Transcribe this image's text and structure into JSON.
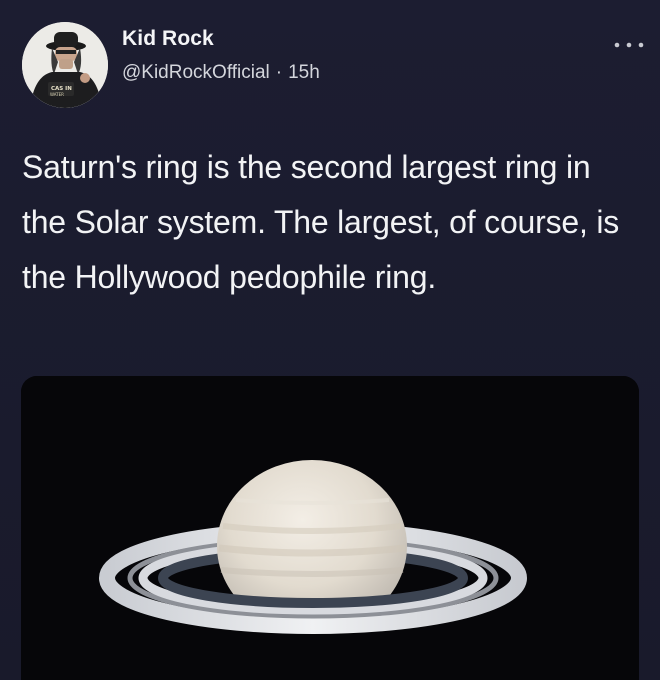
{
  "author": {
    "display_name": "Kid Rock",
    "handle": "@KidRockOfficial",
    "separator": "·",
    "timestamp": "15h",
    "avatar_icon": "user-avatar-icon"
  },
  "menu": {
    "more_label": "···",
    "more_icon": "more-options-icon"
  },
  "tweet": {
    "text": "Saturn's ring is the second largest ring in the Solar system. The largest, of course, is the Hollywood pedophile ring."
  },
  "media": {
    "image_icon": "saturn-photo"
  },
  "colors": {
    "background": "#1b1c2e",
    "text": "#f2f3f5",
    "secondary_text": "#d4d6dc",
    "media_background": "#07070b"
  }
}
